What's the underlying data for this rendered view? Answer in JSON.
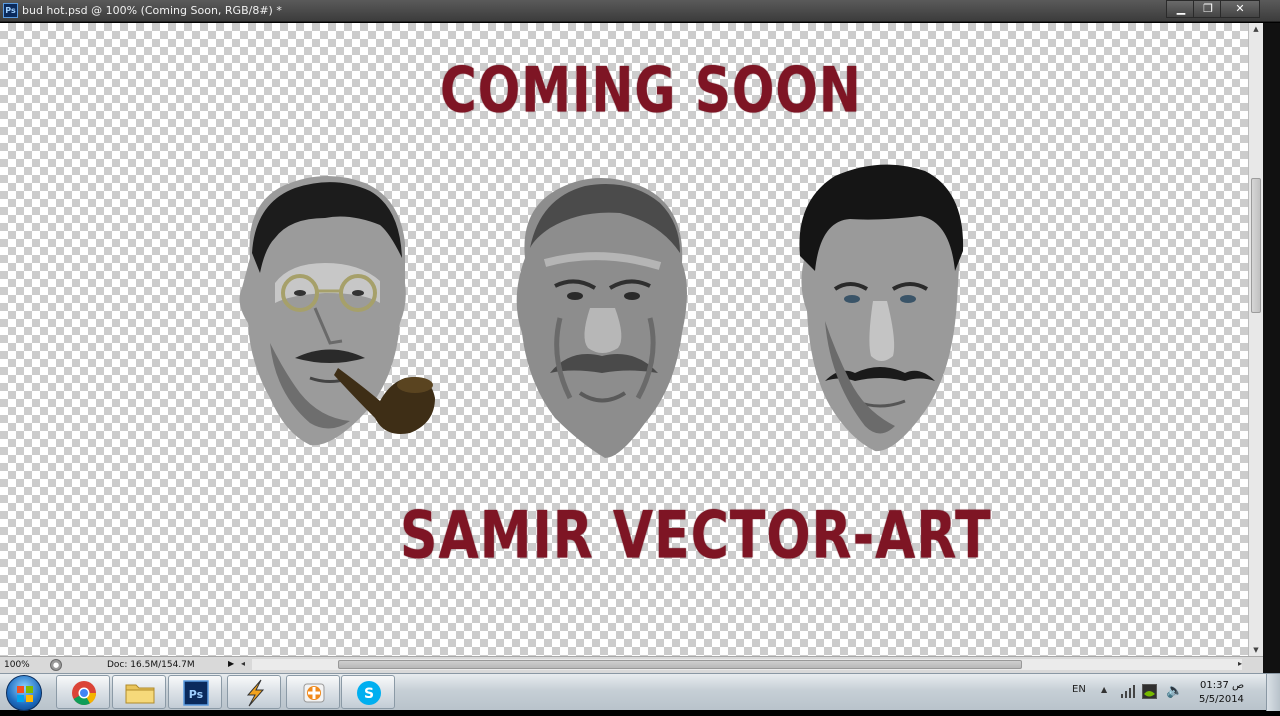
{
  "titlebar": {
    "app_badge": "Ps",
    "document_title": "bud hot.psd @ 100% (Coming Soon, RGB/8#) *"
  },
  "canvas": {
    "heading_top": "COMING SOON",
    "heading_bottom": "SAMIR VECTOR-ART",
    "text_color": "#7e1524",
    "portraits": [
      {
        "label": "man with glasses and pipe",
        "icon": "portrait-glasses-pipe"
      },
      {
        "label": "older man with mustache",
        "icon": "portrait-older-mustache"
      },
      {
        "label": "man with curled mustache",
        "icon": "portrait-curled-mustache"
      }
    ]
  },
  "statusbar": {
    "zoom": "100%",
    "doc_size": "Doc: 16.5M/154.7M"
  },
  "taskbar": {
    "start_icon": "windows-orb-icon",
    "apps": [
      {
        "name": "chrome",
        "icon": "chrome-icon"
      },
      {
        "name": "explorer",
        "icon": "folder-icon"
      },
      {
        "name": "photoshop",
        "icon": "photoshop-icon",
        "badge": "Ps"
      },
      {
        "name": "winamp",
        "icon": "winamp-icon"
      },
      {
        "name": "avast",
        "icon": "avast-icon"
      },
      {
        "name": "skype",
        "icon": "skype-icon",
        "badge": "S"
      }
    ],
    "tray": {
      "language": "EN",
      "time": "01:37 ص",
      "date": "5/5/2014"
    }
  }
}
